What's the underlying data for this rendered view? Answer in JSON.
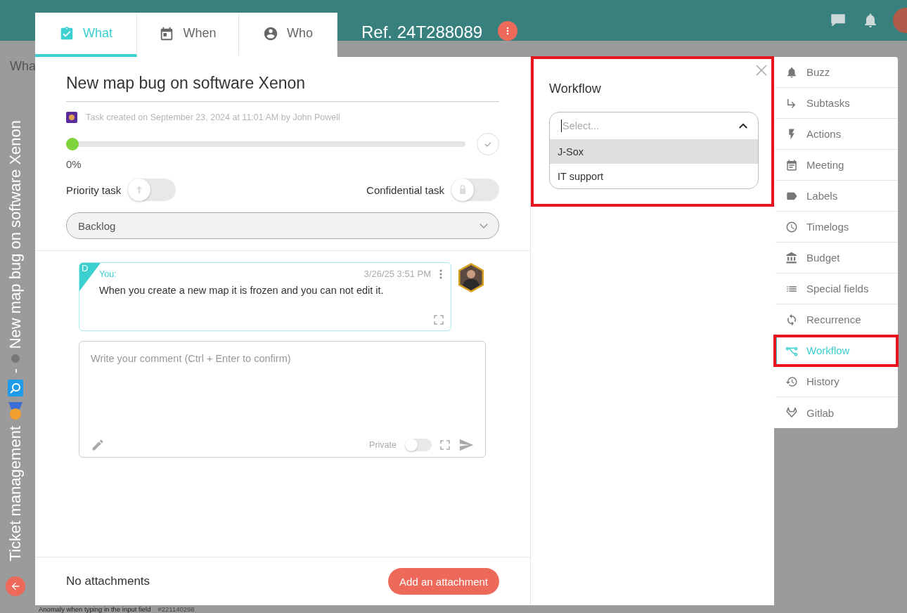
{
  "background": {
    "header_text": "Wha",
    "row_text": "Anomaly when typing in the input field",
    "row_ref": "#221140298"
  },
  "side_title": {
    "module": "Ticket management",
    "separator": "-",
    "task": "New map bug on software Xenon"
  },
  "tabs": [
    {
      "label": "What",
      "kind": "clipboard",
      "selected": true
    },
    {
      "label": "When",
      "kind": "calendar",
      "selected": false
    },
    {
      "label": "Who",
      "kind": "person",
      "selected": false
    }
  ],
  "ref": "Ref. 24T288089",
  "task": {
    "title": "New map bug on software Xenon",
    "created": "Task created on September 23, 2024 at 11:01 AM by John Powell",
    "progress": {
      "level": 0,
      "reading": "0%",
      "done": false
    },
    "priority": {
      "label": "Priority task",
      "on": false
    },
    "confidential": {
      "label": "Confidential task",
      "on": false
    },
    "status": "Backlog"
  },
  "comments": [
    {
      "badge": "D",
      "author": "You:",
      "time": "3/26/25 3:51 PM",
      "text": "When you create a new map it is frozen and you can not edit it."
    }
  ],
  "comment_box": {
    "placeholder": "Write your comment (Ctrl + Enter to confirm)",
    "private_label": "Private",
    "private": false
  },
  "attachments": {
    "text": "No attachments",
    "button": "Add an attachment"
  },
  "workflow_panel": {
    "title": "Workflow",
    "highlighted": true,
    "placeholder": "Select...",
    "expanded": true,
    "options": [
      {
        "label": "J-Sox",
        "selected": true
      },
      {
        "label": "IT support",
        "selected": false
      }
    ]
  },
  "side_menu": [
    {
      "label": "Buzz",
      "kind": "bell",
      "selected": false,
      "highlighted": false
    },
    {
      "label": "Subtasks",
      "kind": "subtask",
      "selected": false,
      "highlighted": false
    },
    {
      "label": "Actions",
      "kind": "bolt",
      "selected": false,
      "highlighted": false
    },
    {
      "label": "Meeting",
      "kind": "meeting",
      "selected": false,
      "highlighted": false
    },
    {
      "label": "Labels",
      "kind": "label",
      "selected": false,
      "highlighted": false
    },
    {
      "label": "Timelogs",
      "kind": "clock",
      "selected": false,
      "highlighted": false
    },
    {
      "label": "Budget",
      "kind": "bank",
      "selected": false,
      "highlighted": false
    },
    {
      "label": "Special fields",
      "kind": "list",
      "selected": false,
      "highlighted": false
    },
    {
      "label": "Recurrence",
      "kind": "sync",
      "selected": false,
      "highlighted": false
    },
    {
      "label": "Workflow",
      "kind": "workflow",
      "selected": true,
      "highlighted": true
    },
    {
      "label": "History",
      "kind": "history",
      "selected": false,
      "highlighted": false
    },
    {
      "label": "Gitlab",
      "kind": "gitlab",
      "selected": false,
      "highlighted": false
    }
  ]
}
